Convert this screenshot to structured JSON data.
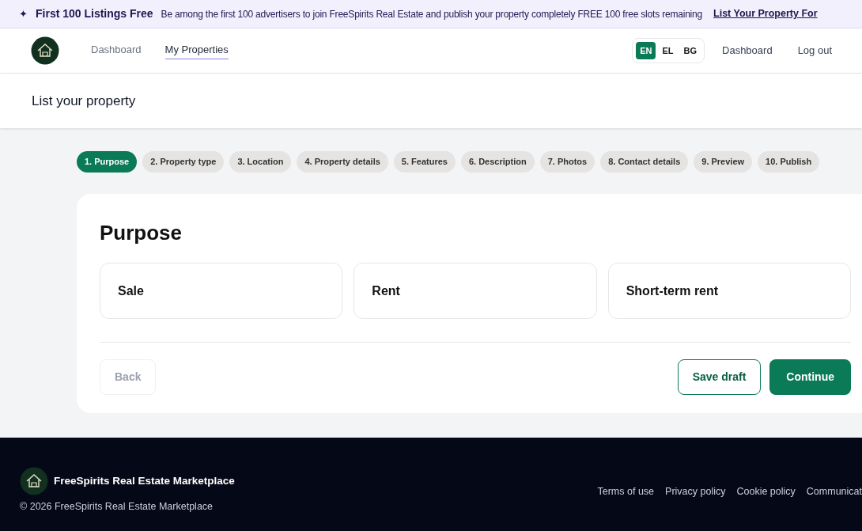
{
  "banner": {
    "icon": "✦",
    "title": "First 100 Listings Free",
    "message": "Be among the first 100 advertisers to join FreeSpirits Real Estate and publish your property completely FREE 100 free slots remaining",
    "link": "List Your Property For"
  },
  "header": {
    "nav": [
      {
        "label": "Dashboard",
        "selected": false
      },
      {
        "label": "My Properties",
        "selected": true
      }
    ],
    "languages": [
      {
        "label": "EN",
        "selected": true
      },
      {
        "label": "EL",
        "selected": false
      },
      {
        "label": "BG",
        "selected": false
      }
    ],
    "links": [
      "Dashboard",
      "Log out"
    ]
  },
  "page_title": "List your property",
  "steps": [
    {
      "label": "1. Purpose",
      "selected": true
    },
    {
      "label": "2. Property type",
      "selected": false
    },
    {
      "label": "3. Location",
      "selected": false
    },
    {
      "label": "4. Property details",
      "selected": false
    },
    {
      "label": "5. Features",
      "selected": false
    },
    {
      "label": "6. Description",
      "selected": false
    },
    {
      "label": "7. Photos",
      "selected": false
    },
    {
      "label": "8. Contact details",
      "selected": false
    },
    {
      "label": "9. Preview",
      "selected": false
    },
    {
      "label": "10. Publish",
      "selected": false
    }
  ],
  "card": {
    "heading": "Purpose",
    "options": [
      {
        "label": "Sale",
        "selected": false
      },
      {
        "label": "Rent",
        "selected": false
      },
      {
        "label": "Short-term rent",
        "selected": false
      }
    ],
    "back": {
      "label": "Back",
      "disabled": true
    },
    "save_draft": "Save draft",
    "continue": "Continue"
  },
  "footer": {
    "brand": "FreeSpirits Real Estate Marketplace",
    "copyright": "© 2026 FreeSpirits Real Estate Marketplace",
    "links": [
      "Terms of use",
      "Privacy policy",
      "Cookie policy",
      "Communicat"
    ]
  }
}
